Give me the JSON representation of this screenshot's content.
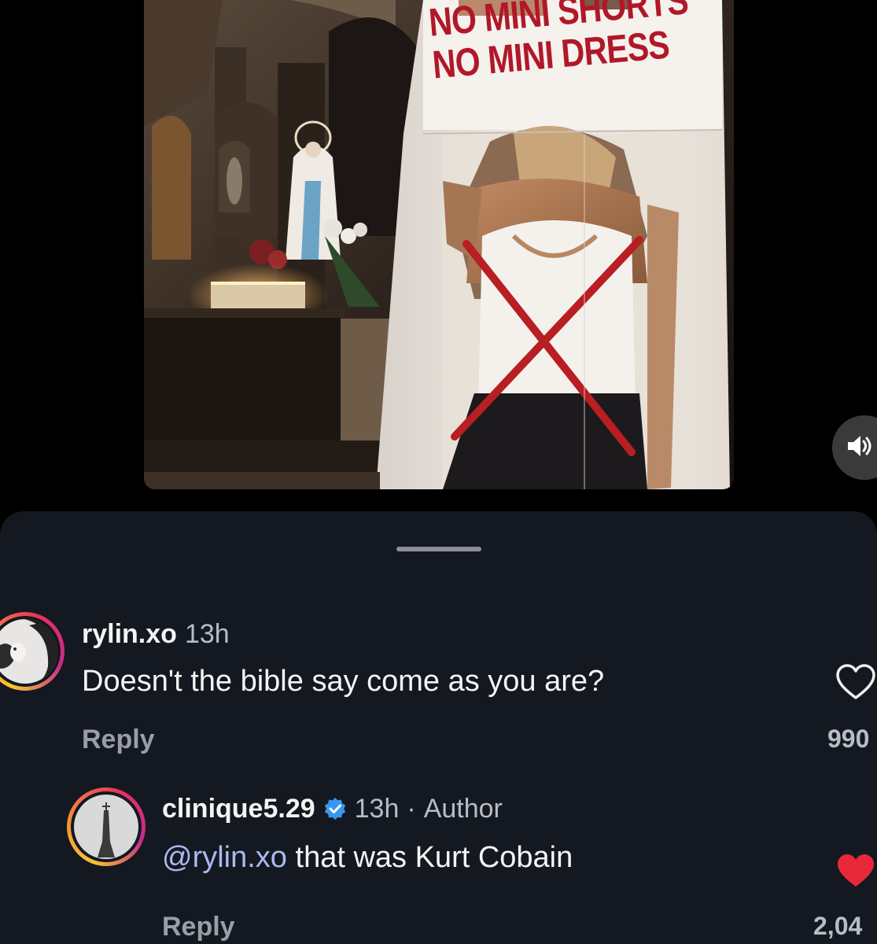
{
  "post": {
    "sign_lines": [
      "NO MINI SHORTS",
      "NO MINI DRESS"
    ],
    "mute_icon": "speaker-muted-icon"
  },
  "comments": [
    {
      "username": "rylin.xo",
      "time": "13h",
      "text": "Doesn't the bible say come as you are?",
      "reply_label": "Reply",
      "like_count": "990",
      "liked": false,
      "like_icon": "heart-outline-icon"
    },
    {
      "username": "clinique5.29",
      "verified": true,
      "verified_icon": "verified-badge-icon",
      "time": "13h",
      "separator": "·",
      "author_label": "Author",
      "mention": "@rylin.xo",
      "text": "that was Kurt Cobain",
      "reply_label": "Reply",
      "like_count": "2,04",
      "liked": true,
      "like_color": "#e8283a",
      "like_icon": "heart-filled-icon"
    }
  ],
  "theme": {
    "sheet_bg": "#141820",
    "accent_link": "#a9b9f2",
    "verified_blue": "#3797f0",
    "sign_red": "#b0182a"
  }
}
